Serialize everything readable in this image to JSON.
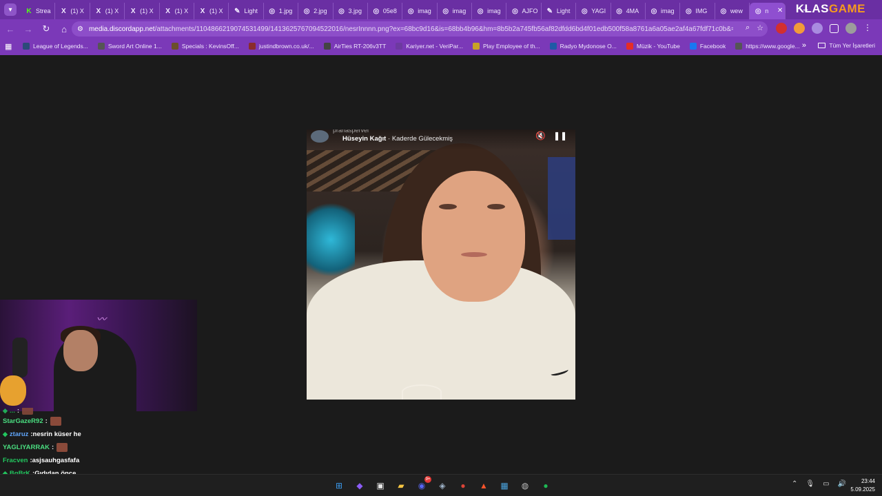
{
  "tabs": [
    {
      "label": "Strea",
      "icon": "K"
    },
    {
      "label": "(1) X",
      "icon": "X"
    },
    {
      "label": "(1) X",
      "icon": "X"
    },
    {
      "label": "(1) X",
      "icon": "X"
    },
    {
      "label": "(1) X",
      "icon": "X"
    },
    {
      "label": "(1) X",
      "icon": "X"
    },
    {
      "label": "Light",
      "icon": "✎"
    },
    {
      "label": "1.jpg",
      "icon": "◎"
    },
    {
      "label": "2.jpg",
      "icon": "◎"
    },
    {
      "label": "3.jpg",
      "icon": "◎"
    },
    {
      "label": "05e8",
      "icon": "◎"
    },
    {
      "label": "imag",
      "icon": "◎"
    },
    {
      "label": "imag",
      "icon": "◎"
    },
    {
      "label": "imag",
      "icon": "◎"
    },
    {
      "label": "AJFO",
      "icon": "◎"
    },
    {
      "label": "Light",
      "icon": "✎"
    },
    {
      "label": "YAGI",
      "icon": "◎"
    },
    {
      "label": "4MA",
      "icon": "◎"
    },
    {
      "label": "imag",
      "icon": "◎"
    },
    {
      "label": "IMG",
      "icon": "◎"
    },
    {
      "label": "wew",
      "icon": "◎"
    },
    {
      "label": "n",
      "icon": "◎",
      "active": true
    }
  ],
  "brand": {
    "part1": "KLAS",
    "part2": "GAME"
  },
  "address": {
    "host": "media.discordapp.net",
    "path": "/attachments/1104866219074531499/1413625767094522016/nesrInnnn.png?ex=68bc9d16&is=68bb4b96&hm=8b5b2a745fb56af82dfdd6bd4f01edb500f58a8761a6a05ae2af4a67fdf71c0b&=&format=we..."
  },
  "bookmarks": [
    {
      "label": "League of Legends...",
      "color": "#2c4a7a"
    },
    {
      "label": "Sword Art Online 1...",
      "color": "#555555"
    },
    {
      "label": "Specials : KevinsOff...",
      "color": "#6b4f2a"
    },
    {
      "label": "justindbrown.co.uk/...",
      "color": "#8a2c2c"
    },
    {
      "label": "AirTies RT-206v3TT",
      "color": "#444444"
    },
    {
      "label": "Kariyer.net - VeriPar...",
      "color": "#6d3aa0"
    },
    {
      "label": "Play Employee of th...",
      "color": "#c9a227"
    },
    {
      "label": "Radyo Mydonose O...",
      "color": "#1f5aa6"
    },
    {
      "label": "Müzik - YouTube",
      "color": "#e52d27"
    },
    {
      "label": "Facebook",
      "color": "#1877f2"
    },
    {
      "label": "https://www.google...",
      "color": "#555555"
    }
  ],
  "bookmarks_all": "Tüm Yer İşaretleri",
  "media": {
    "clip_user": "pranaspervei",
    "artist": "Hüseyin Kağıt",
    "separator": " · ",
    "song": "Kaderde Gülecekmiş"
  },
  "chat": [
    {
      "user": "...",
      "color": "#22c55e",
      "text": "",
      "emote": true,
      "badge": true,
      "partial": true
    },
    {
      "user": "StarGazeR92",
      "color": "#4ade80",
      "text": "",
      "emote": true,
      "badge": false
    },
    {
      "user": "ztaruz",
      "color": "#60a5fa",
      "text": "nesrin küser he",
      "emote": false,
      "badge": true
    },
    {
      "user": "YAGLIYARRAK",
      "color": "#4ade80",
      "text": "",
      "emote": true,
      "badge": false
    },
    {
      "user": "Fracven",
      "color": "#22c55e",
      "text": "asjsauhgasfafa",
      "emote": false,
      "badge": false
    },
    {
      "user": "BgBrK",
      "color": "#22c55e",
      "text": "Gıdıdan önce",
      "emote": false,
      "badge": true
    }
  ],
  "taskbar": {
    "apps": [
      {
        "name": "windows-start-icon",
        "glyph": "⊞",
        "color": "#3b9cf0"
      },
      {
        "name": "copilot-icon",
        "glyph": "◆",
        "color": "#8b5cf6"
      },
      {
        "name": "store-icon",
        "glyph": "▣",
        "color": "#e6e6e6"
      },
      {
        "name": "file-explorer-icon",
        "glyph": "▰",
        "color": "#f5c542"
      },
      {
        "name": "discord-icon",
        "glyph": "◉",
        "color": "#5865f2",
        "badge": "9+"
      },
      {
        "name": "steam-icon",
        "glyph": "◈",
        "color": "#9fb3c8"
      },
      {
        "name": "chrome-icon",
        "glyph": "●",
        "color": "#db4437"
      },
      {
        "name": "brave-icon",
        "glyph": "▲",
        "color": "#fb542b"
      },
      {
        "name": "photos-icon",
        "glyph": "▦",
        "color": "#4aa3df"
      },
      {
        "name": "obs-icon",
        "glyph": "◍",
        "color": "#bbbbbb"
      },
      {
        "name": "spotify-icon",
        "glyph": "●",
        "color": "#1db954"
      }
    ],
    "time": "23:44",
    "date": "5.09.2025"
  }
}
